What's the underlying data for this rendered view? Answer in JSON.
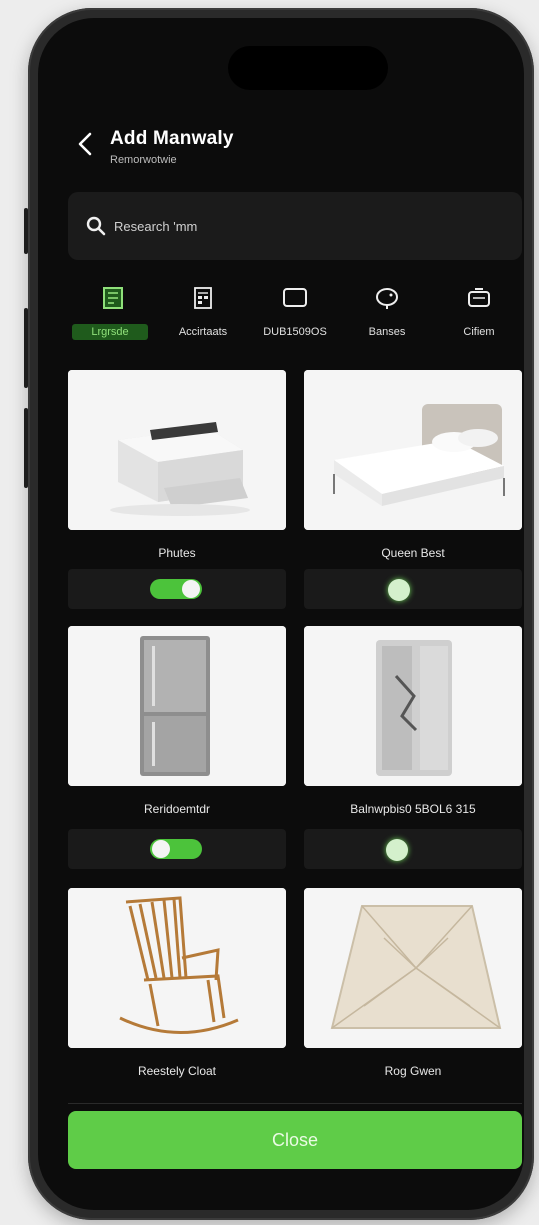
{
  "header": {
    "title": "Add Manwaly",
    "subtitle": "Remorwotwie"
  },
  "search": {
    "placeholder": "Research 'mm"
  },
  "categories": [
    {
      "label": "Lrgrsde",
      "icon": "grid-book-icon",
      "active": true
    },
    {
      "label": "Accirtaats",
      "icon": "calendar-icon",
      "active": false
    },
    {
      "label": "DUB1509OS",
      "icon": "monitor-icon",
      "active": false
    },
    {
      "label": "Banses",
      "icon": "tv-icon",
      "active": false
    },
    {
      "label": "Cifiem",
      "icon": "battery-icon",
      "active": false
    }
  ],
  "items": [
    {
      "name": "Phutes",
      "image": "printer",
      "toggle": "on"
    },
    {
      "name": "Queen Best",
      "image": "bed",
      "toggle": "off"
    },
    {
      "name": "Reridoemtdr",
      "image": "fridge",
      "toggle": "on"
    },
    {
      "name": "Balnwpbis0 5BOL6 315",
      "image": "fridge-door",
      "toggle": "off"
    },
    {
      "name": "Reestely Cloat",
      "image": "rocking-chair",
      "toggle": null
    },
    {
      "name": "Rog Gwen",
      "image": "rug",
      "toggle": null
    }
  ],
  "footer": {
    "close_label": "Close"
  },
  "colors": {
    "accent": "#5fcc48",
    "background": "#0c0c0c",
    "card": "#f3f3f3"
  }
}
